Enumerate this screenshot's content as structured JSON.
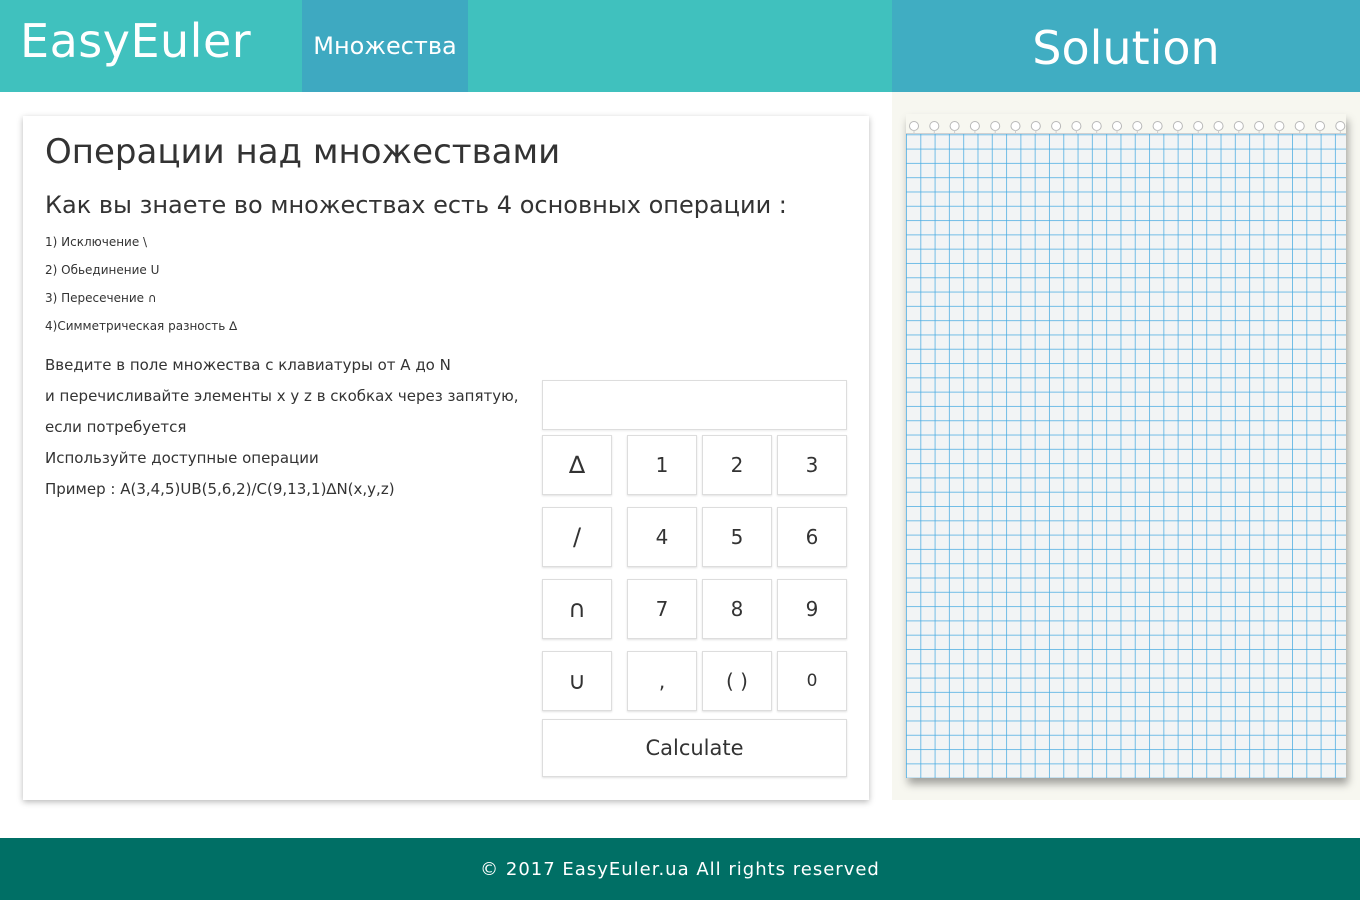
{
  "header": {
    "logo": "EasyEuler",
    "nav_tab": "Множества",
    "solution_title": "Solution"
  },
  "main": {
    "title": "Операции над множествами",
    "subtitle": "Как вы знаете во множествах есть 4 основных операции :",
    "operations": [
      "1) Исключение   \\",
      "2) Обьединение U",
      "3) Пересечение ∩",
      "4)Симметрическая разность ∆"
    ],
    "instructions": [
      "Введите в поле множества с клавиатуры от A до N",
      "и перечисливайте элементы x y z в скобках через запятую,",
      "если потребуется",
      "Используйте доступные операции",
      "Пример : A(3,4,5)UB(5,6,2)/C(9,13,1)∆N(x,y,z)"
    ]
  },
  "calculator": {
    "display_value": "",
    "op_keys": [
      "∆",
      "/",
      "∩",
      "∪"
    ],
    "num_keys": [
      "1",
      "2",
      "3",
      "4",
      "5",
      "6",
      "7",
      "8",
      "9",
      ",",
      "( )",
      "0"
    ],
    "calculate_label": "Calculate"
  },
  "footer": {
    "copyright": "© 2017 EasyEuler.ua All rights reserved"
  },
  "colors": {
    "header_teal": "#40c1be",
    "nav_tab": "#3ea9c1",
    "solution_header": "#40adc2",
    "footer": "#006f65",
    "grid_line": "#46aae1"
  }
}
